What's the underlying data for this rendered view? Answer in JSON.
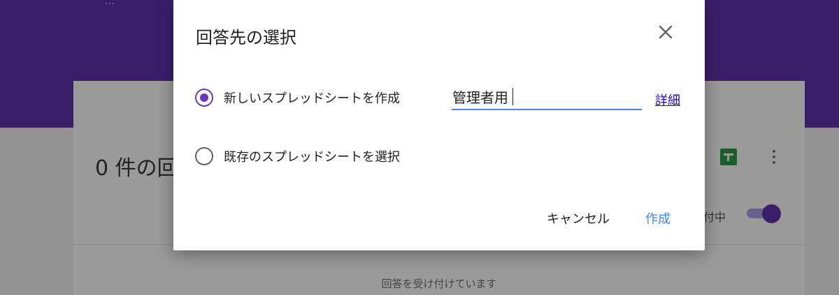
{
  "background": {
    "header_text": "…",
    "response_count_title": "0 件の回",
    "accepting_label": "付中",
    "status_text": "回答を受け付けています",
    "colors": {
      "header": "#3a1f68",
      "toggle": "#3a1f68",
      "sheets_icon": "#1b5e2b"
    }
  },
  "dialog": {
    "title": "回答先の選択",
    "options": [
      {
        "label": "新しいスプレッドシートを作成",
        "selected": true
      },
      {
        "label": "既存のスプレッドシートを選択",
        "selected": false
      }
    ],
    "name_input": {
      "value": "管理者用"
    },
    "details_link": "詳細",
    "cancel_label": "キャンセル",
    "create_label": "作成",
    "colors": {
      "accent": "#673ab7",
      "link": "#1a0dab",
      "primary_button": "#4285f4"
    }
  }
}
